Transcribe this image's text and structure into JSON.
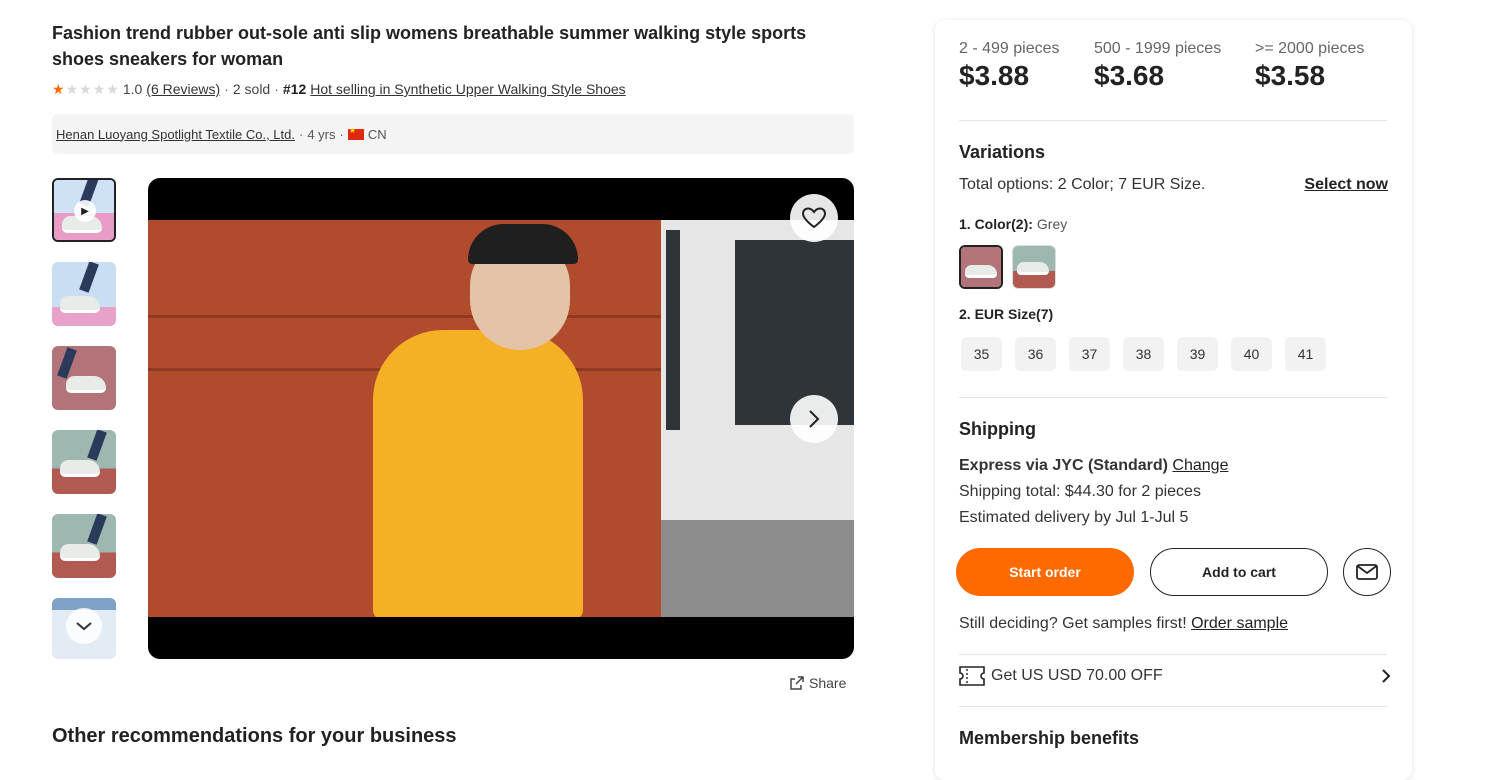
{
  "product": {
    "title": "Fashion trend rubber out-sole anti slip womens breathable summer walking style sports shoes sneakers for woman",
    "rating": "1.0",
    "rating_stars": 1,
    "reviews": "(6 Reviews)",
    "sold": "2 sold",
    "rank": "#12",
    "rank_text": "Hot selling in Synthetic Upper Walking Style Shoes"
  },
  "supplier": {
    "name": "Henan Luoyang Spotlight Textile Co., Ltd.",
    "years": "4 yrs",
    "country": "CN"
  },
  "media": {
    "share_label": "Share"
  },
  "recommendations_title": "Other recommendations for your business",
  "pricing": [
    {
      "qty": "2 - 499 pieces",
      "price": "$3.88"
    },
    {
      "qty": "500 - 1999 pieces",
      "price": "$3.68"
    },
    {
      "qty": ">= 2000 pieces",
      "price": "$3.58"
    }
  ],
  "variations": {
    "title": "Variations",
    "total_label": "Total options:",
    "total_value": "2 Color; 7 EUR Size.",
    "select_now": "Select now",
    "color_label": "1. Color(2):",
    "color_selected": "Grey",
    "size_label": "2. EUR Size(7)",
    "sizes": [
      "35",
      "36",
      "37",
      "38",
      "39",
      "40",
      "41"
    ]
  },
  "shipping": {
    "title": "Shipping",
    "method": "Express via JYC (Standard)",
    "change": "Change",
    "total": "Shipping total: $44.30 for 2 pieces",
    "delivery": "Estimated delivery by Jul 1-Jul 5"
  },
  "actions": {
    "start_order": "Start order",
    "add_to_cart": "Add to cart"
  },
  "samples": {
    "text": "Still deciding? Get samples first!",
    "link": "Order sample"
  },
  "coupon": {
    "text": "Get US USD 70.00 OFF"
  },
  "membership_title": "Membership benefits",
  "colors": {
    "accent": "#ff6a00",
    "text": "#222222"
  }
}
